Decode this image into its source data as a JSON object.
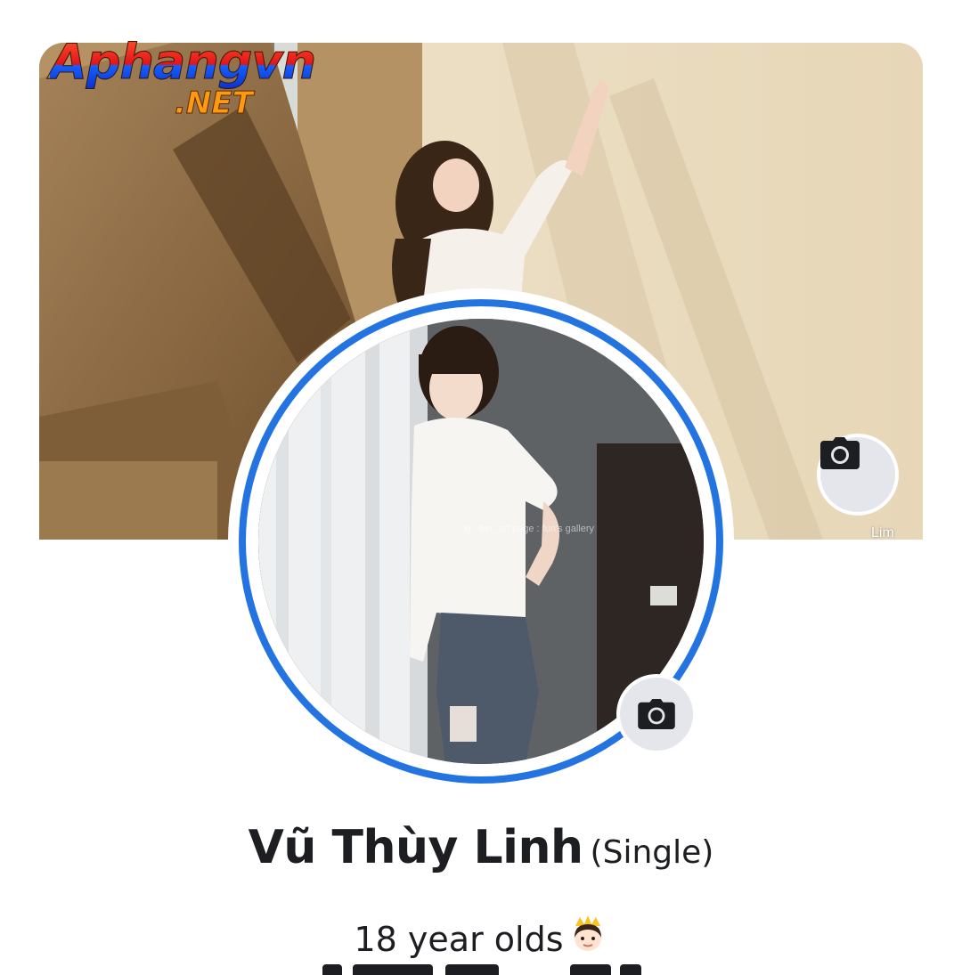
{
  "watermark": {
    "brand": "Aphangvn",
    "suffix": ".NET"
  },
  "cover": {
    "photo_credit": "Lim",
    "camera_button_icon": "camera-icon"
  },
  "profile_picture": {
    "photo_watermark": "ig : fun_art     page : fun's gallery",
    "camera_button_icon": "camera-icon",
    "ring_color": "#2374e1"
  },
  "profile": {
    "name": "Vũ Thùy Linh",
    "name_suffix": "(Single)",
    "bio_text": "18 year olds",
    "bio_emoji": "princess-emoji"
  },
  "colors": {
    "background": "#ffffff",
    "text_primary": "#1c1e21",
    "button_bg": "#e4e6eb",
    "accent": "#2374e1"
  }
}
